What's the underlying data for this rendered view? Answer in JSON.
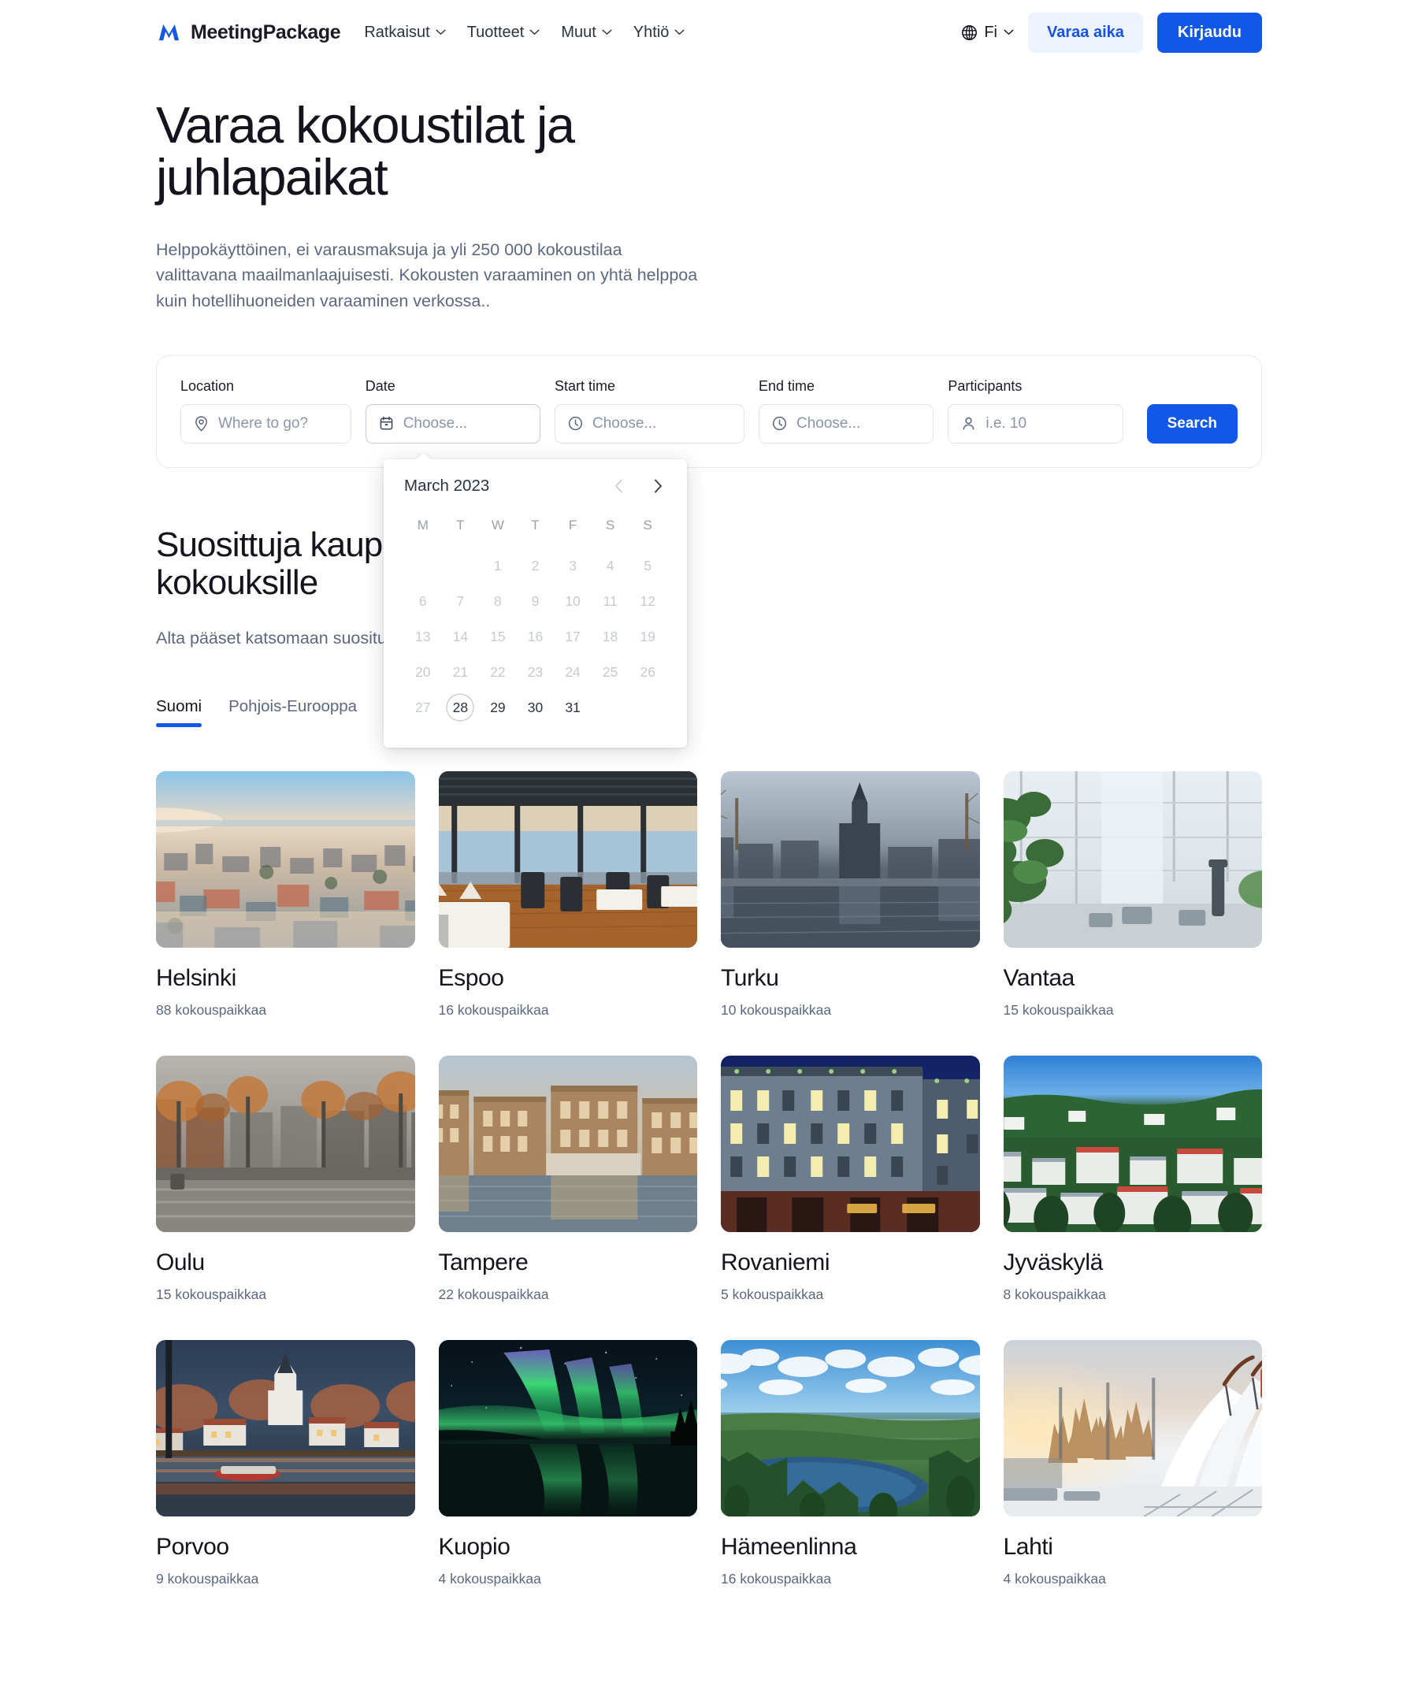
{
  "header": {
    "brand": "MeetingPackage",
    "nav": [
      {
        "label": "Ratkaisut"
      },
      {
        "label": "Tuotteet"
      },
      {
        "label": "Muut"
      },
      {
        "label": "Yhtiö"
      }
    ],
    "language": "Fi",
    "book_demo_label": "Varaa aika",
    "login_label": "Kirjaudu"
  },
  "hero": {
    "title": "Varaa kokoustilat ja juhlapaikat",
    "subtitle": "Helppokäyttöinen, ei varausmaksuja ja yli 250 000 kokoustilaa valittavana maailmanlaajuisesti. Kokousten varaaminen on yhtä helppoa kuin hotellihuoneiden varaaminen verkossa.."
  },
  "search": {
    "location_label": "Location",
    "location_placeholder": "Where to go?",
    "location_value": "",
    "date_label": "Date",
    "date_placeholder": "Choose...",
    "date_value": "",
    "start_label": "Start time",
    "start_placeholder": "Choose...",
    "start_value": "",
    "end_label": "End time",
    "end_placeholder": "Choose...",
    "end_value": "",
    "participants_label": "Participants",
    "participants_placeholder": "i.e. 10",
    "participants_value": "",
    "search_button": "Search"
  },
  "calendar": {
    "month": "March 2023",
    "weekdays": [
      "M",
      "T",
      "W",
      "T",
      "F",
      "S",
      "S"
    ],
    "leading_blanks": 2,
    "days": [
      {
        "n": "1",
        "state": "disabled"
      },
      {
        "n": "2",
        "state": "disabled"
      },
      {
        "n": "3",
        "state": "disabled"
      },
      {
        "n": "4",
        "state": "disabled"
      },
      {
        "n": "5",
        "state": "disabled"
      },
      {
        "n": "6",
        "state": "disabled"
      },
      {
        "n": "7",
        "state": "disabled"
      },
      {
        "n": "8",
        "state": "disabled"
      },
      {
        "n": "9",
        "state": "disabled"
      },
      {
        "n": "10",
        "state": "disabled"
      },
      {
        "n": "11",
        "state": "disabled"
      },
      {
        "n": "12",
        "state": "disabled"
      },
      {
        "n": "13",
        "state": "disabled"
      },
      {
        "n": "14",
        "state": "disabled"
      },
      {
        "n": "15",
        "state": "disabled"
      },
      {
        "n": "16",
        "state": "disabled"
      },
      {
        "n": "17",
        "state": "disabled"
      },
      {
        "n": "18",
        "state": "disabled"
      },
      {
        "n": "19",
        "state": "disabled"
      },
      {
        "n": "20",
        "state": "disabled"
      },
      {
        "n": "21",
        "state": "disabled"
      },
      {
        "n": "22",
        "state": "disabled"
      },
      {
        "n": "23",
        "state": "disabled"
      },
      {
        "n": "24",
        "state": "disabled"
      },
      {
        "n": "25",
        "state": "disabled"
      },
      {
        "n": "26",
        "state": "disabled"
      },
      {
        "n": "27",
        "state": "disabled"
      },
      {
        "n": "28",
        "state": "today"
      },
      {
        "n": "29",
        "state": "available"
      },
      {
        "n": "30",
        "state": "available"
      },
      {
        "n": "31",
        "state": "available"
      }
    ],
    "prev_label": "Previous month",
    "next_label": "Next month"
  },
  "popular": {
    "title": "Suosittuja kaupunkeja kokouksille",
    "subtitle": "Alta pääset katsomaan suosituimpia kaupungeista.",
    "tabs": [
      {
        "label": "Suomi",
        "active": true
      },
      {
        "label": "Pohjois-Eurooppa",
        "active": false
      }
    ]
  },
  "cities": [
    {
      "name": "Helsinki",
      "meta": "88 kokouspaikkaa",
      "img": "helsinki-aerial-sunset"
    },
    {
      "name": "Espoo",
      "meta": "16 kokouspaikkaa",
      "img": "espoo-restaurant-interior"
    },
    {
      "name": "Turku",
      "meta": "10 kokouspaikkaa",
      "img": "turku-river-cathedral"
    },
    {
      "name": "Vantaa",
      "meta": "15 kokouspaikkaa",
      "img": "vantaa-atrium-plants"
    },
    {
      "name": "Oulu",
      "meta": "15 kokouspaikkaa",
      "img": "oulu-autumn-street"
    },
    {
      "name": "Tampere",
      "meta": "22 kokouspaikkaa",
      "img": "tampere-brick-factory"
    },
    {
      "name": "Rovaniemi",
      "meta": "5 kokouspaikkaa",
      "img": "rovaniemi-hotel-night"
    },
    {
      "name": "Jyväskylä",
      "meta": "8 kokouspaikkaa",
      "img": "jyvaskyla-town-hills"
    },
    {
      "name": "Porvoo",
      "meta": "9 kokouspaikkaa",
      "img": "porvoo-oldtown-dusk"
    },
    {
      "name": "Kuopio",
      "meta": "4 kokouspaikkaa",
      "img": "kuopio-aurora-lake"
    },
    {
      "name": "Hämeenlinna",
      "meta": "16 kokouspaikkaa",
      "img": "hameenlinna-lake-forest"
    },
    {
      "name": "Lahti",
      "meta": "4 kokouspaikkaa",
      "img": "lahti-ski-jump-winter"
    }
  ],
  "colors": {
    "accent": "#1257e8",
    "accent_soft": "#eef3ff",
    "text": "#14141e",
    "muted": "#5c6880"
  }
}
